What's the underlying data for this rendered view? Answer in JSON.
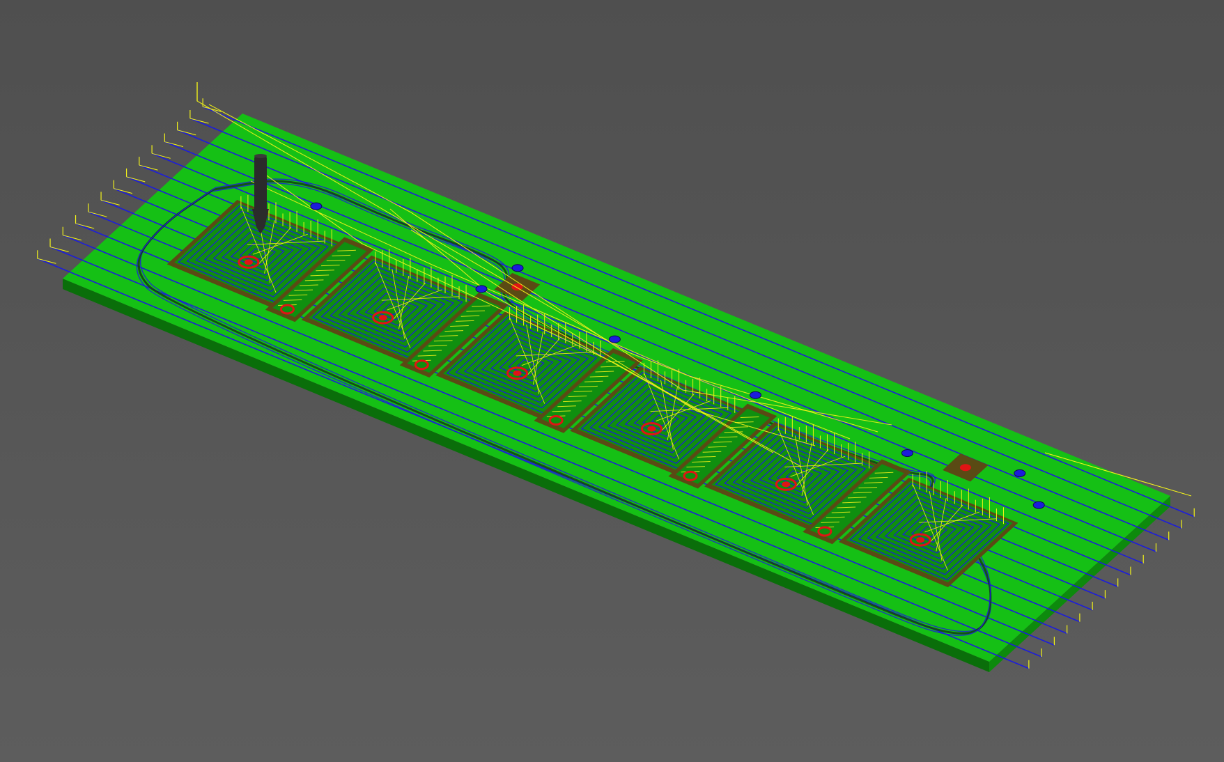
{
  "view": {
    "type": "cam-toolpath-simulation-3d",
    "colors": {
      "background_top": "#4f4f4f",
      "background_bottom": "#5d5d5d",
      "stock_top": "#15c015",
      "stock_edge": "#0d8a0d",
      "stock_side": "#0a6e0a",
      "pocket_floor": "#0f8f0f",
      "pocket_wall": "#5a4a14",
      "feed_moves": "#1c1cdc",
      "rapid_moves": "#f3f31a",
      "plunge_moves": "#e01414",
      "tool": "#2b2b2b"
    }
  },
  "stock": {
    "shape": "rectangular-plate",
    "pockets": 6,
    "slots": 5,
    "small_pockets": 2,
    "holes": 7
  },
  "toolpaths": {
    "facing_passes": 14,
    "contour": "outer-profile",
    "pocket_pattern": "concentric-spiral"
  },
  "tool": {
    "type": "end-mill",
    "visible": true
  }
}
